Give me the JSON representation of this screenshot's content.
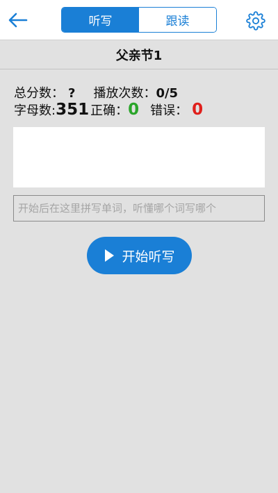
{
  "navbar": {
    "back_icon": "back-arrow-icon",
    "tabs": [
      {
        "label": "听写",
        "active": true
      },
      {
        "label": "跟读",
        "active": false
      }
    ],
    "settings_icon": "gear-icon"
  },
  "title": "父亲节1",
  "stats": {
    "total_score_label": "总分数：",
    "total_score_value": "?",
    "play_count_label": "播放次数：",
    "play_count_value": "0/5",
    "letters_label": "字母数:",
    "letters_value": "351",
    "correct_label": "正确：",
    "correct_value": "0",
    "wrong_label": "错误：",
    "wrong_value": "0"
  },
  "input": {
    "placeholder": "开始后在这里拼写单词，听懂哪个词写哪个",
    "value": ""
  },
  "start_button": {
    "label": "开始听写",
    "icon": "play-icon"
  },
  "colors": {
    "accent": "#1a7fd6",
    "correct": "#2aa52a",
    "wrong": "#e0201c",
    "background": "#e1e1e1"
  }
}
